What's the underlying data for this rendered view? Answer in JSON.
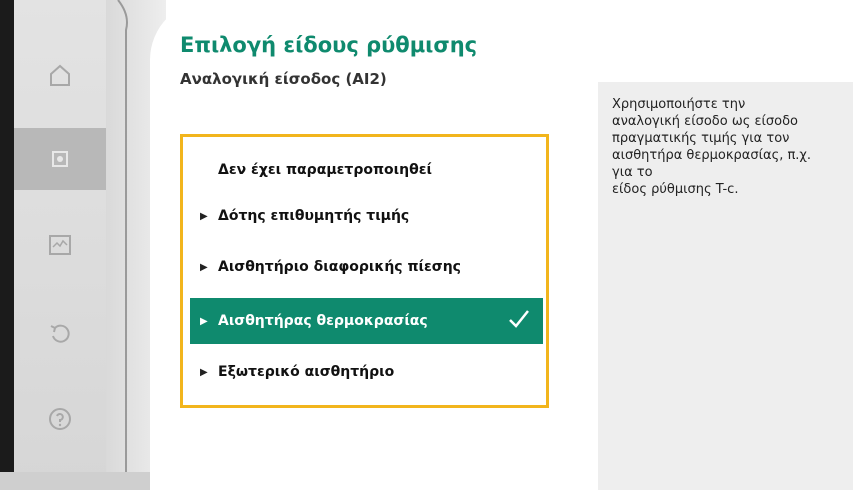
{
  "header": {
    "title": "Επιλογή είδους ρύθμισης",
    "subtitle": "Αναλογική είσοδος (AI2)"
  },
  "sidebar": {
    "items": [
      {
        "icon": "home-icon",
        "active": false
      },
      {
        "icon": "settings-icon",
        "active": true
      },
      {
        "icon": "diagnostics-icon",
        "active": false
      },
      {
        "icon": "restore-icon",
        "active": false
      },
      {
        "icon": "help-icon",
        "active": false
      }
    ]
  },
  "options": {
    "items": [
      {
        "label": "Δεν έχει παραμετροποιηθεί",
        "has_arrow": false,
        "selected": false
      },
      {
        "label": "Δότης επιθυμητής τιμής",
        "has_arrow": true,
        "selected": false
      },
      {
        "label": "Αισθητήριο διαφορικής πίεσης",
        "has_arrow": true,
        "selected": false
      },
      {
        "label": "Αισθητήρας θερμοκρασίας",
        "has_arrow": true,
        "selected": true
      },
      {
        "label": "Εξωτερικό αισθητήριο",
        "has_arrow": true,
        "selected": false
      }
    ]
  },
  "info": {
    "text": "Χρησιμοποιήστε την\nαναλογική είσοδο ως είσοδο\nπραγματικής τιμής για τον\nαισθητήρα θερμοκρασίας, π.χ.\nγια το\nείδος ρύθμισης T-c."
  },
  "colors": {
    "accent": "#0f8a6e",
    "focus_frame": "#f2b51c",
    "sidebar_bg": "#dcdcdc",
    "info_bg": "#eeeeee"
  }
}
